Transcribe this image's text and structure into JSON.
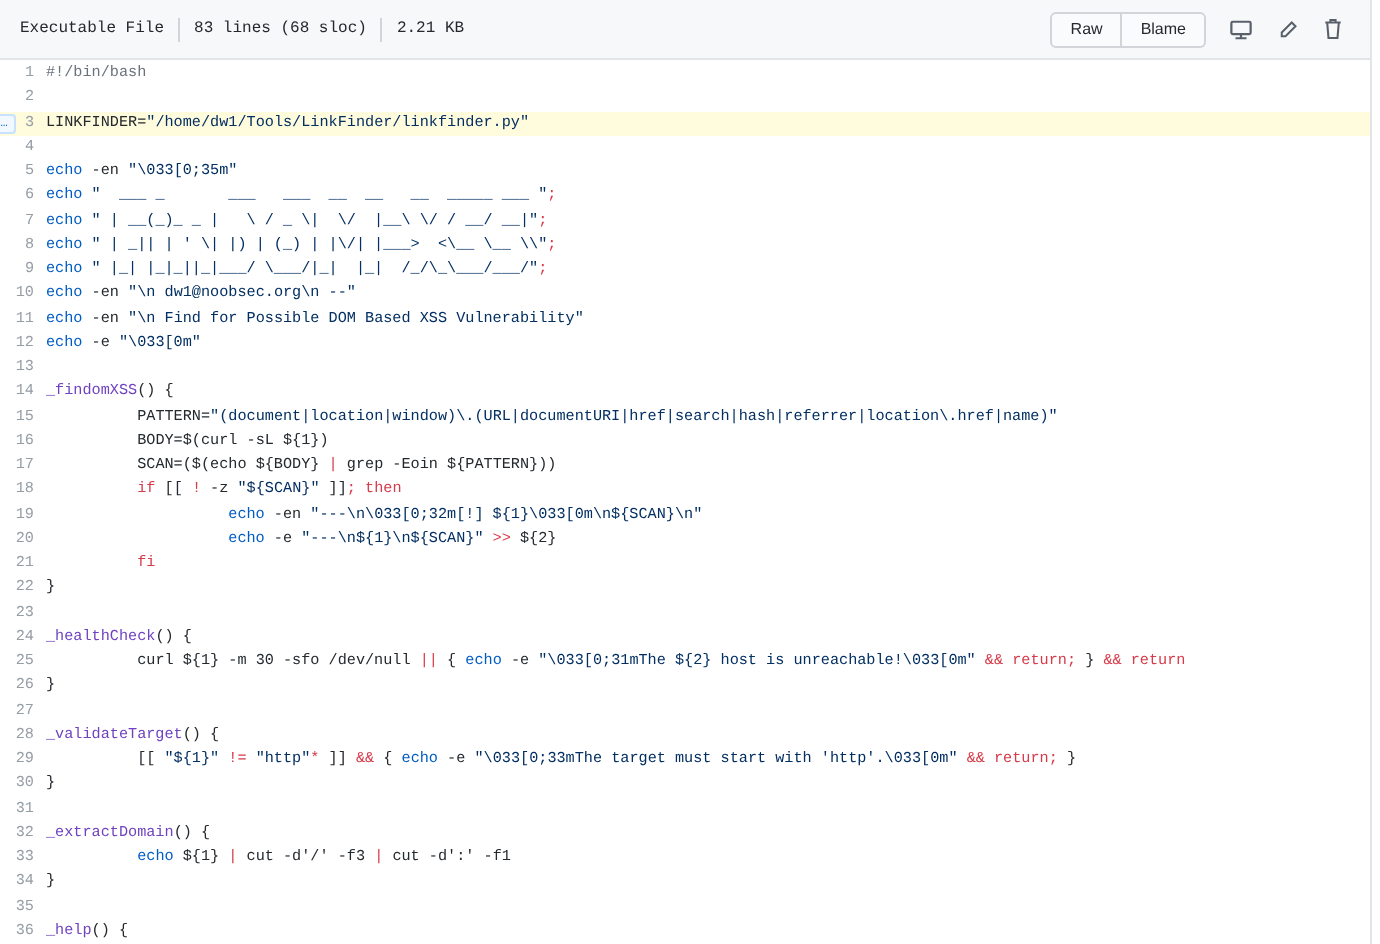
{
  "file_info": [
    "Executable File",
    "83 lines (68 sloc)",
    "2.21 KB"
  ],
  "buttons": [
    "Raw",
    "Blame"
  ],
  "expand_button": "…",
  "lines": [
    {
      "number": "1",
      "highlighted": false,
      "tokens": [
        {
          "text": "#!/bin/bash",
          "kind": "comment"
        }
      ]
    },
    {
      "number": "2",
      "highlighted": false
    },
    {
      "number": "3",
      "highlighted": true,
      "tokens": [
        {
          "text": "LINKFINDER=",
          "kind": "plain"
        },
        {
          "text": "\"/home/dw1/Tools/LinkFinder/linkfinder.py\"",
          "kind": "str"
        }
      ]
    },
    {
      "number": "4",
      "highlighted": false
    },
    {
      "number": "5",
      "highlighted": false,
      "tokens": [
        {
          "text": "echo",
          "kind": "builtin"
        },
        {
          "text": " -en ",
          "kind": "plain"
        },
        {
          "text": "\"\\033[0;35m\"",
          "kind": "str"
        }
      ]
    },
    {
      "number": "6",
      "highlighted": false,
      "tokens": [
        {
          "text": "echo",
          "kind": "builtin"
        },
        {
          "text": " \"  ___ _       ___   ___  __  __   __  _____ ___ \"",
          "kind": "str"
        },
        {
          "text": ";",
          "kind": "kw"
        }
      ]
    },
    {
      "number": "7",
      "highlighted": false,
      "tokens": [
        {
          "text": "echo",
          "kind": "builtin"
        },
        {
          "text": " \" | __(_)_ _ |   \\ / _ \\|  \\/  |__\\ \\/ / __/ __|\"",
          "kind": "str"
        },
        {
          "text": ";",
          "kind": "kw"
        }
      ]
    },
    {
      "number": "8",
      "highlighted": false,
      "tokens": [
        {
          "text": "echo",
          "kind": "builtin"
        },
        {
          "text": " \" | _|| | ' \\| |) | (_) | |\\/| |___>  <\\__ \\__ \\\\\"",
          "kind": "str"
        },
        {
          "text": ";",
          "kind": "kw"
        }
      ]
    },
    {
      "number": "9",
      "highlighted": false,
      "tokens": [
        {
          "text": "echo",
          "kind": "builtin"
        },
        {
          "text": " \" |_| |_|_||_|___/ \\___/|_|  |_|  /_/\\_\\___/___/\"",
          "kind": "str"
        },
        {
          "text": ";",
          "kind": "kw"
        }
      ]
    },
    {
      "number": "10",
      "highlighted": false,
      "tokens": [
        {
          "text": "echo",
          "kind": "builtin"
        },
        {
          "text": " -en ",
          "kind": "plain"
        },
        {
          "text": "\"\\n dw1@noobsec.org\\n --\"",
          "kind": "str"
        }
      ]
    },
    {
      "number": "11",
      "highlighted": false,
      "tokens": [
        {
          "text": "echo",
          "kind": "builtin"
        },
        {
          "text": " -en ",
          "kind": "plain"
        },
        {
          "text": "\"\\n Find for Possible DOM Based XSS Vulnerability\"",
          "kind": "str"
        }
      ]
    },
    {
      "number": "12",
      "highlighted": false,
      "tokens": [
        {
          "text": "echo",
          "kind": "builtin"
        },
        {
          "text": " -e ",
          "kind": "plain"
        },
        {
          "text": "\"\\033[0m\"",
          "kind": "str"
        }
      ]
    },
    {
      "number": "13",
      "highlighted": false
    },
    {
      "number": "14",
      "highlighted": false,
      "tokens": [
        {
          "text": "_findomXSS",
          "kind": "fn"
        },
        {
          "text": "() {",
          "kind": "plain"
        }
      ]
    },
    {
      "number": "15",
      "highlighted": false,
      "tokens": [
        {
          "text": "\tPATTERN=",
          "kind": "plain"
        },
        {
          "text": "\"(document|location|window)\\.(URL|documentURI|href|search|hash|referrer|location\\.href|name)\"",
          "kind": "str"
        }
      ]
    },
    {
      "number": "16",
      "highlighted": false,
      "tokens": [
        {
          "text": "\tBODY=$(curl -sL ${1})",
          "kind": "plain"
        }
      ]
    },
    {
      "number": "17",
      "highlighted": false,
      "tokens": [
        {
          "text": "\tSCAN=($(echo ${BODY} ",
          "kind": "plain"
        },
        {
          "text": "|",
          "kind": "kw"
        },
        {
          "text": " grep -Eoin ${PATTERN}))",
          "kind": "plain"
        }
      ]
    },
    {
      "number": "18",
      "highlighted": false,
      "tokens": [
        {
          "text": "\tif",
          "kind": "kw"
        },
        {
          "text": " [[ ",
          "kind": "plain"
        },
        {
          "text": "!",
          "kind": "kw"
        },
        {
          "text": " -z ",
          "kind": "plain"
        },
        {
          "text": "\"${SCAN}\"",
          "kind": "str"
        },
        {
          "text": " ]]",
          "kind": "plain"
        },
        {
          "text": "; then",
          "kind": "kw"
        }
      ]
    },
    {
      "number": "19",
      "highlighted": false,
      "tokens": [
        {
          "text": "\t\techo",
          "kind": "builtin"
        },
        {
          "text": " -en ",
          "kind": "plain"
        },
        {
          "text": "\"---\\n\\033[0;32m[!] ${1}\\033[0m\\n${SCAN}\\n\"",
          "kind": "str"
        }
      ]
    },
    {
      "number": "20",
      "highlighted": false,
      "tokens": [
        {
          "text": "\t\techo",
          "kind": "builtin"
        },
        {
          "text": " -e ",
          "kind": "plain"
        },
        {
          "text": "\"---\\n${1}\\n${SCAN}\"",
          "kind": "str"
        },
        {
          "text": " >>",
          "kind": "kw"
        },
        {
          "text": " ${2}",
          "kind": "plain"
        }
      ]
    },
    {
      "number": "21",
      "highlighted": false,
      "tokens": [
        {
          "text": "\tfi",
          "kind": "kw"
        }
      ]
    },
    {
      "number": "22",
      "highlighted": false,
      "tokens": [
        {
          "text": "}",
          "kind": "plain"
        }
      ]
    },
    {
      "number": "23",
      "highlighted": false
    },
    {
      "number": "24",
      "highlighted": false,
      "tokens": [
        {
          "text": "_healthCheck",
          "kind": "fn"
        },
        {
          "text": "() {",
          "kind": "plain"
        }
      ]
    },
    {
      "number": "25",
      "highlighted": false,
      "tokens": [
        {
          "text": "\tcurl ${1} -m 30 -sfo /dev/null ",
          "kind": "plain"
        },
        {
          "text": "||",
          "kind": "kw"
        },
        {
          "text": " { ",
          "kind": "plain"
        },
        {
          "text": "echo",
          "kind": "builtin"
        },
        {
          "text": " -e ",
          "kind": "plain"
        },
        {
          "text": "\"\\033[0;31mThe ${2} host is unreachable!\\033[0m\"",
          "kind": "str"
        },
        {
          "text": " && return;",
          "kind": "kw"
        },
        {
          "text": " } ",
          "kind": "plain"
        },
        {
          "text": "&& return",
          "kind": "kw"
        }
      ]
    },
    {
      "number": "26",
      "highlighted": false,
      "tokens": [
        {
          "text": "}",
          "kind": "plain"
        }
      ]
    },
    {
      "number": "27",
      "highlighted": false
    },
    {
      "number": "28",
      "highlighted": false,
      "tokens": [
        {
          "text": "_validateTarget",
          "kind": "fn"
        },
        {
          "text": "() {",
          "kind": "plain"
        }
      ]
    },
    {
      "number": "29",
      "highlighted": false,
      "tokens": [
        {
          "text": "\t[[ ",
          "kind": "plain"
        },
        {
          "text": "\"${1}\"",
          "kind": "str"
        },
        {
          "text": " !=",
          "kind": "kw"
        },
        {
          "text": " \"http\"",
          "kind": "str"
        },
        {
          "text": "*",
          "kind": "kw"
        },
        {
          "text": " ]] ",
          "kind": "plain"
        },
        {
          "text": "&&",
          "kind": "kw"
        },
        {
          "text": " { ",
          "kind": "plain"
        },
        {
          "text": "echo",
          "kind": "builtin"
        },
        {
          "text": " -e ",
          "kind": "plain"
        },
        {
          "text": "\"\\033[0;33mThe target must start with 'http'.\\033[0m\"",
          "kind": "str"
        },
        {
          "text": " && return;",
          "kind": "kw"
        },
        {
          "text": " }",
          "kind": "plain"
        }
      ]
    },
    {
      "number": "30",
      "highlighted": false,
      "tokens": [
        {
          "text": "}",
          "kind": "plain"
        }
      ]
    },
    {
      "number": "31",
      "highlighted": false
    },
    {
      "number": "32",
      "highlighted": false,
      "tokens": [
        {
          "text": "_extractDomain",
          "kind": "fn"
        },
        {
          "text": "() {",
          "kind": "plain"
        }
      ]
    },
    {
      "number": "33",
      "highlighted": false,
      "tokens": [
        {
          "text": "\techo",
          "kind": "builtin"
        },
        {
          "text": " ${1} ",
          "kind": "plain"
        },
        {
          "text": "|",
          "kind": "kw"
        },
        {
          "text": " cut -d'/' -f3 ",
          "kind": "plain"
        },
        {
          "text": "|",
          "kind": "kw"
        },
        {
          "text": " cut -d':' -f1",
          "kind": "plain"
        }
      ]
    },
    {
      "number": "34",
      "highlighted": false,
      "tokens": [
        {
          "text": "}",
          "kind": "plain"
        }
      ]
    },
    {
      "number": "35",
      "highlighted": false
    },
    {
      "number": "36",
      "highlighted": false,
      "tokens": [
        {
          "text": "_help",
          "kind": "fn"
        },
        {
          "text": "() {",
          "kind": "plain"
        }
      ]
    }
  ]
}
